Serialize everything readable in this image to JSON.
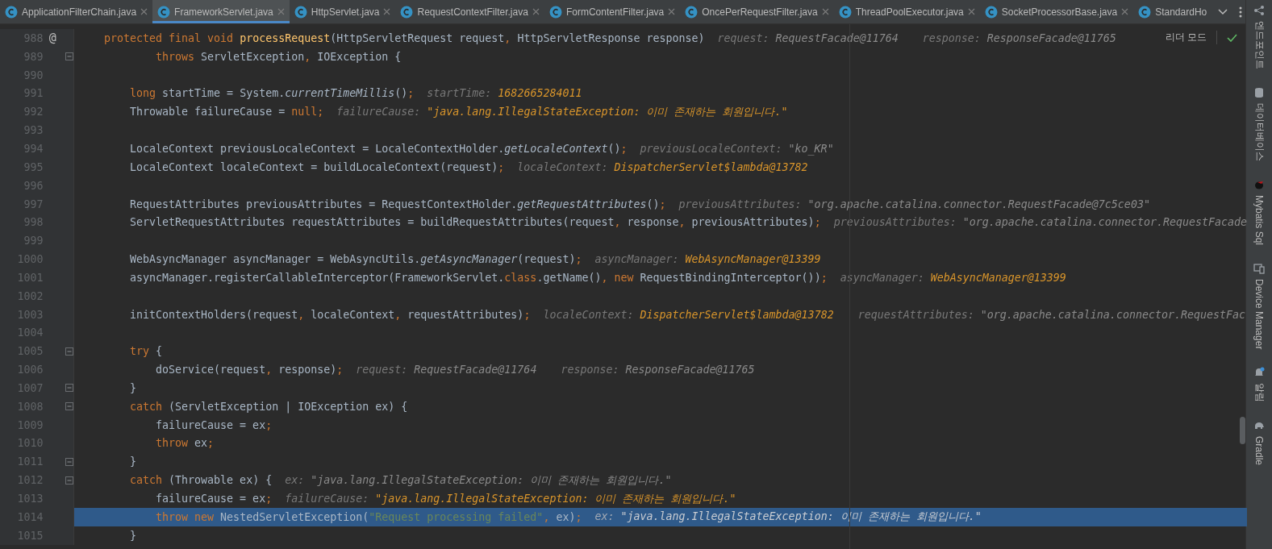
{
  "tabs": [
    {
      "label": "ApplicationFilterChain.java",
      "selected": false
    },
    {
      "label": "FrameworkServlet.java",
      "selected": true
    },
    {
      "label": "HttpServlet.java",
      "selected": false
    },
    {
      "label": "RequestContextFilter.java",
      "selected": false
    },
    {
      "label": "FormContentFilter.java",
      "selected": false
    },
    {
      "label": "OncePerRequestFilter.java",
      "selected": false
    },
    {
      "label": "ThreadPoolExecutor.java",
      "selected": false
    },
    {
      "label": "SocketProcessorBase.java",
      "selected": false
    },
    {
      "label": "StandardHo",
      "selected": false
    }
  ],
  "reader_mode": {
    "label": "리더 모드"
  },
  "lines": [
    {
      "number": "988",
      "marker": "@",
      "fold": false,
      "selected": false,
      "tokens": [
        {
          "text": "protected final void ",
          "kind": "keyword"
        },
        {
          "text": "processRequest",
          "kind": "method"
        },
        {
          "text": "(HttpServletRequest request",
          "kind": "plain"
        },
        {
          "text": ", ",
          "kind": "punctuation"
        },
        {
          "text": "HttpServletResponse response)",
          "kind": "plain"
        }
      ],
      "hints": [
        {
          "label": "request:",
          "value": "RequestFacade@11764",
          "changed": false
        },
        {
          "label": "response:",
          "value": "ResponseFacade@11765",
          "changed": false
        }
      ]
    },
    {
      "number": "989",
      "fold": true,
      "selected": false,
      "tokens": [
        {
          "text": "        throws ",
          "kind": "keyword"
        },
        {
          "text": "ServletException",
          "kind": "plain"
        },
        {
          "text": ", ",
          "kind": "punctuation"
        },
        {
          "text": "IOException {",
          "kind": "plain"
        }
      ]
    },
    {
      "number": "990",
      "fold": false,
      "selected": false
    },
    {
      "number": "991",
      "fold": false,
      "selected": false,
      "tokens": [
        {
          "text": "    long ",
          "kind": "keyword"
        },
        {
          "text": "startTime = System.",
          "kind": "plain"
        },
        {
          "text": "currentTimeMillis",
          "kind": "static"
        },
        {
          "text": "()",
          "kind": "plain"
        },
        {
          "text": ";",
          "kind": "punctuation"
        }
      ],
      "hints": [
        {
          "label": "startTime:",
          "value": "1682665284011",
          "changed": true
        }
      ]
    },
    {
      "number": "992",
      "fold": false,
      "selected": false,
      "tokens": [
        {
          "text": "    Throwable failureCause = ",
          "kind": "plain"
        },
        {
          "text": "null",
          "kind": "keyword"
        },
        {
          "text": ";",
          "kind": "punctuation"
        }
      ],
      "hints": [
        {
          "label": "failureCause:",
          "value": "\"java.lang.IllegalStateException: 이미 존재하는 회원입니다.\"",
          "changed": true
        }
      ]
    },
    {
      "number": "993",
      "fold": false,
      "selected": false
    },
    {
      "number": "994",
      "fold": false,
      "selected": false,
      "tokens": [
        {
          "text": "    LocaleContext previousLocaleContext = LocaleContextHolder.",
          "kind": "plain"
        },
        {
          "text": "getLocaleContext",
          "kind": "static"
        },
        {
          "text": "()",
          "kind": "plain"
        },
        {
          "text": ";",
          "kind": "punctuation"
        }
      ],
      "hints": [
        {
          "label": "previousLocaleContext:",
          "value": "\"ko_KR\"",
          "changed": false
        }
      ]
    },
    {
      "number": "995",
      "fold": false,
      "selected": false,
      "tokens": [
        {
          "text": "    LocaleContext localeContext = buildLocaleContext(request)",
          "kind": "plain"
        },
        {
          "text": ";",
          "kind": "punctuation"
        }
      ],
      "hints": [
        {
          "label": "localeContext:",
          "value": "DispatcherServlet$lambda@13782",
          "changed": true
        }
      ]
    },
    {
      "number": "996",
      "fold": false,
      "selected": false
    },
    {
      "number": "997",
      "fold": false,
      "selected": false,
      "tokens": [
        {
          "text": "    RequestAttributes previousAttributes = RequestContextHolder.",
          "kind": "plain"
        },
        {
          "text": "getRequestAttributes",
          "kind": "static"
        },
        {
          "text": "()",
          "kind": "plain"
        },
        {
          "text": ";",
          "kind": "punctuation"
        }
      ],
      "hints": [
        {
          "label": "previousAttributes:",
          "value": "\"org.apache.catalina.connector.RequestFacade@7c5ce03\"",
          "changed": false
        }
      ]
    },
    {
      "number": "998",
      "fold": false,
      "selected": false,
      "tokens": [
        {
          "text": "    ServletRequestAttributes requestAttributes = buildRequestAttributes(request",
          "kind": "plain"
        },
        {
          "text": ", ",
          "kind": "punctuation"
        },
        {
          "text": "response",
          "kind": "plain"
        },
        {
          "text": ", ",
          "kind": "punctuation"
        },
        {
          "text": "previousAttributes)",
          "kind": "plain"
        },
        {
          "text": ";",
          "kind": "punctuation"
        }
      ],
      "hints": [
        {
          "label": "previousAttributes:",
          "value": "\"org.apache.catalina.connector.RequestFacade",
          "changed": false
        }
      ]
    },
    {
      "number": "999",
      "fold": false,
      "selected": false
    },
    {
      "number": "1000",
      "fold": false,
      "selected": false,
      "tokens": [
        {
          "text": "    WebAsyncManager asyncManager = WebAsyncUtils.",
          "kind": "plain"
        },
        {
          "text": "getAsyncManager",
          "kind": "static"
        },
        {
          "text": "(request)",
          "kind": "plain"
        },
        {
          "text": ";",
          "kind": "punctuation"
        }
      ],
      "hints": [
        {
          "label": "asyncManager:",
          "value": "WebAsyncManager@13399",
          "changed": true
        }
      ]
    },
    {
      "number": "1001",
      "fold": false,
      "selected": false,
      "tokens": [
        {
          "text": "    asyncManager.registerCallableInterceptor(FrameworkServlet.",
          "kind": "plain"
        },
        {
          "text": "class",
          "kind": "keyword"
        },
        {
          "text": ".getName()",
          "kind": "plain"
        },
        {
          "text": ", ",
          "kind": "punctuation"
        },
        {
          "text": "new ",
          "kind": "keyword"
        },
        {
          "text": "RequestBindingInterceptor())",
          "kind": "plain"
        },
        {
          "text": ";",
          "kind": "punctuation"
        }
      ],
      "hints": [
        {
          "label": "asyncManager:",
          "value": "WebAsyncManager@13399",
          "changed": true
        }
      ]
    },
    {
      "number": "1002",
      "fold": false,
      "selected": false
    },
    {
      "number": "1003",
      "fold": false,
      "selected": false,
      "tokens": [
        {
          "text": "    initContextHolders(request",
          "kind": "plain"
        },
        {
          "text": ", ",
          "kind": "punctuation"
        },
        {
          "text": "localeContext",
          "kind": "plain"
        },
        {
          "text": ", ",
          "kind": "punctuation"
        },
        {
          "text": "requestAttributes)",
          "kind": "plain"
        },
        {
          "text": ";",
          "kind": "punctuation"
        }
      ],
      "hints": [
        {
          "label": "localeContext:",
          "value": "DispatcherServlet$lambda@13782",
          "changed": true
        },
        {
          "label": "requestAttributes:",
          "value": "\"org.apache.catalina.connector.RequestFac",
          "changed": false
        }
      ]
    },
    {
      "number": "1004",
      "fold": false,
      "selected": false
    },
    {
      "number": "1005",
      "fold": true,
      "selected": false,
      "tokens": [
        {
          "text": "    try ",
          "kind": "keyword"
        },
        {
          "text": "{",
          "kind": "plain"
        }
      ]
    },
    {
      "number": "1006",
      "fold": false,
      "selected": false,
      "tokens": [
        {
          "text": "        doService(request",
          "kind": "plain"
        },
        {
          "text": ", ",
          "kind": "punctuation"
        },
        {
          "text": "response)",
          "kind": "plain"
        },
        {
          "text": ";",
          "kind": "punctuation"
        }
      ],
      "hints": [
        {
          "label": "request:",
          "value": "RequestFacade@11764",
          "changed": false
        },
        {
          "label": "response:",
          "value": "ResponseFacade@11765",
          "changed": false
        }
      ]
    },
    {
      "number": "1007",
      "fold": true,
      "selected": false,
      "tokens": [
        {
          "text": "    }",
          "kind": "plain"
        }
      ]
    },
    {
      "number": "1008",
      "fold": true,
      "selected": false,
      "tokens": [
        {
          "text": "    catch ",
          "kind": "keyword"
        },
        {
          "text": "(ServletException | IOException ex) {",
          "kind": "plain"
        }
      ]
    },
    {
      "number": "1009",
      "fold": false,
      "selected": false,
      "tokens": [
        {
          "text": "        failureCause = ex",
          "kind": "plain"
        },
        {
          "text": ";",
          "kind": "punctuation"
        }
      ]
    },
    {
      "number": "1010",
      "fold": false,
      "selected": false,
      "tokens": [
        {
          "text": "        throw ",
          "kind": "keyword"
        },
        {
          "text": "ex",
          "kind": "plain"
        },
        {
          "text": ";",
          "kind": "punctuation"
        }
      ]
    },
    {
      "number": "1011",
      "fold": true,
      "selected": false,
      "tokens": [
        {
          "text": "    }",
          "kind": "plain"
        }
      ]
    },
    {
      "number": "1012",
      "fold": true,
      "selected": false,
      "tokens": [
        {
          "text": "    catch ",
          "kind": "keyword"
        },
        {
          "text": "(Throwable ex) {",
          "kind": "plain"
        }
      ],
      "hints": [
        {
          "label": "ex:",
          "value": "\"java.lang.IllegalStateException: 이미 존재하는 회원입니다.\"",
          "changed": false
        }
      ]
    },
    {
      "number": "1013",
      "fold": false,
      "selected": false,
      "tokens": [
        {
          "text": "        failureCause = ex",
          "kind": "plain"
        },
        {
          "text": ";",
          "kind": "punctuation"
        }
      ],
      "hints": [
        {
          "label": "failureCause:",
          "value": "\"java.lang.IllegalStateException: 이미 존재하는 회원입니다.\"",
          "changed": true
        }
      ]
    },
    {
      "number": "1014",
      "fold": false,
      "selected": true,
      "tokens": [
        {
          "text": "        throw new ",
          "kind": "keyword"
        },
        {
          "text": "NestedServletException(",
          "kind": "plain"
        },
        {
          "text": "\"Request processing failed\"",
          "kind": "string"
        },
        {
          "text": ", ",
          "kind": "punctuation"
        },
        {
          "text": "ex)",
          "kind": "plain"
        },
        {
          "text": ";",
          "kind": "punctuation"
        }
      ],
      "hints": [
        {
          "label": "ex:",
          "value": "\"java.lang.IllegalStateException: 이미 존재하는 회원입니다.\"",
          "changed": false
        }
      ]
    },
    {
      "number": "1015",
      "fold": false,
      "selected": false,
      "tokens": [
        {
          "text": "    }",
          "kind": "plain"
        }
      ]
    }
  ],
  "sidebar": [
    {
      "label": "엔드포인트",
      "kind": "endpoints"
    },
    {
      "label": "데이터베이스",
      "kind": "database"
    },
    {
      "label": "Mybatis Sql",
      "kind": "mybatis"
    },
    {
      "label": "Device Manager",
      "kind": "device"
    },
    {
      "label": "알림",
      "kind": "notifications"
    },
    {
      "label": "Gradle",
      "kind": "gradle"
    }
  ]
}
